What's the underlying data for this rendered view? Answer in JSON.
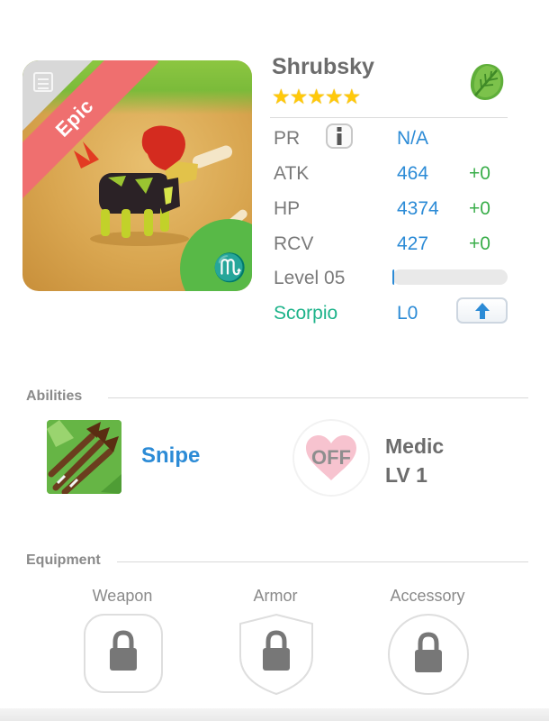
{
  "monster": {
    "name": "Shrubsky",
    "rarity": "Epic",
    "stars": "★★★★★",
    "star_count": 5,
    "element_icon": "leaf-icon",
    "zodiac_symbol": "♏"
  },
  "stats": {
    "pr": {
      "label": "PR",
      "value": "N/A"
    },
    "atk": {
      "label": "ATK",
      "value": "464",
      "bonus": "+0"
    },
    "hp": {
      "label": "HP",
      "value": "4374",
      "bonus": "+0"
    },
    "rcv": {
      "label": "RCV",
      "value": "427",
      "bonus": "+0"
    },
    "level": {
      "label": "Level 05",
      "progress_fraction": 0.01
    },
    "zodiac": {
      "label": "Scorpio",
      "value": "L0"
    }
  },
  "abilities": {
    "title": "Abilities",
    "ability_name": "Snipe",
    "skill_toggle": "OFF",
    "skill_name": "Medic",
    "skill_level": "LV 1"
  },
  "equipment": {
    "title": "Equipment",
    "slots": [
      {
        "label": "Weapon",
        "icon": "lock-icon"
      },
      {
        "label": "Armor",
        "icon": "lock-icon"
      },
      {
        "label": "Accessory",
        "icon": "lock-icon"
      }
    ]
  },
  "colors": {
    "accent_blue": "#2c8bd6",
    "bonus_green": "#3aae4a",
    "zodiac_teal": "#1db38a",
    "epic_red": "#ef6f6f",
    "star_gold": "#ffc90a"
  }
}
